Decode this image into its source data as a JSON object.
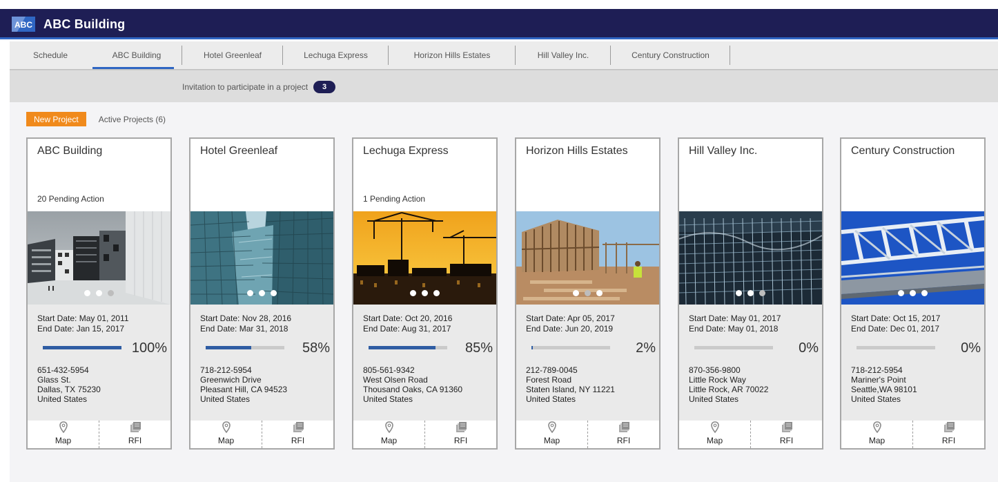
{
  "app": {
    "title": "ABC Building",
    "logo_text": "ABC"
  },
  "tabs": [
    {
      "label": "Schedule"
    },
    {
      "label": "ABC Building"
    },
    {
      "label": "Hotel Greenleaf"
    },
    {
      "label": "Lechuga Express"
    },
    {
      "label": "Horizon Hills Estates"
    },
    {
      "label": "Hill Valley Inc."
    },
    {
      "label": "Century Construction"
    }
  ],
  "invitation": {
    "text": "Invitation to participate in a project",
    "count": "3"
  },
  "toolbar": {
    "new_project": "New Project",
    "active_projects": "Active Projects (6)"
  },
  "projects": [
    {
      "title": "ABC Building",
      "pending": "20 Pending Action",
      "start": "Start Date: May 01, 2011",
      "end": "End Date: Jan 15, 2017",
      "progress": 100,
      "progress_label": "100%",
      "phone": "651-432-5954",
      "street": "Glass St.",
      "city": "Dallas, TX 75230",
      "country": "United States",
      "map_label": "Map",
      "rfi_label": "RFI",
      "active_slide": 2
    },
    {
      "title": "Hotel Greenleaf",
      "pending": "",
      "start": "Start Date: Nov 28, 2016",
      "end": "End Date: Mar 31, 2018",
      "progress": 58,
      "progress_label": "58%",
      "phone": "718-212-5954",
      "street": "Greenwich Drive",
      "city": "Pleasant Hill, CA 94523",
      "country": "United States",
      "map_label": "Map",
      "rfi_label": "RFI",
      "active_slide": 0
    },
    {
      "title": "Lechuga Express",
      "pending": "1 Pending Action",
      "start": "Start Date: Oct 20, 2016",
      "end": "End Date: Aug 31, 2017",
      "progress": 85,
      "progress_label": "85%",
      "phone": "805-561-9342",
      "street": "West Olsen Road",
      "city": "Thousand Oaks, CA 91360",
      "country": "United States",
      "map_label": "Map",
      "rfi_label": "RFI",
      "active_slide": 0
    },
    {
      "title": "Horizon Hills Estates",
      "pending": "",
      "start": "Start Date: Apr 05, 2017",
      "end": "End Date: Jun 20, 2019",
      "progress": 2,
      "progress_label": "2%",
      "phone": "212-789-0045",
      "street": "Forest Road",
      "city": "Staten Island, NY 11221",
      "country": "United States",
      "map_label": "Map",
      "rfi_label": "RFI",
      "active_slide": 1
    },
    {
      "title": "Hill Valley Inc.",
      "pending": "",
      "start": "Start Date: May 01, 2017",
      "end": "End Date: May 01, 2018",
      "progress": 0,
      "progress_label": "0%",
      "phone": "870-356-9800",
      "street": "Little Rock Way",
      "city": "Little Rock, AR 70022",
      "country": "United States",
      "map_label": "Map",
      "rfi_label": "RFI",
      "active_slide": 2
    },
    {
      "title": "Century Construction",
      "pending": "",
      "start": "Start Date: Oct 15, 2017",
      "end": "End Date: Dec 01, 2017",
      "progress": 0,
      "progress_label": "0%",
      "phone": "718-212-5954",
      "street": "Mariner's Point",
      "city": "Seattle,WA 98101",
      "country": "United States",
      "map_label": "Map",
      "rfi_label": "RFI",
      "active_slide": 0
    }
  ],
  "colors": {
    "brand_bar": "#1e1e55",
    "accent_blue": "#2f66c3",
    "progress_fill": "#2f5da3",
    "new_button": "#f08a1c"
  },
  "icons": {
    "map": "map-pin-icon",
    "rfi": "documents-icon"
  }
}
